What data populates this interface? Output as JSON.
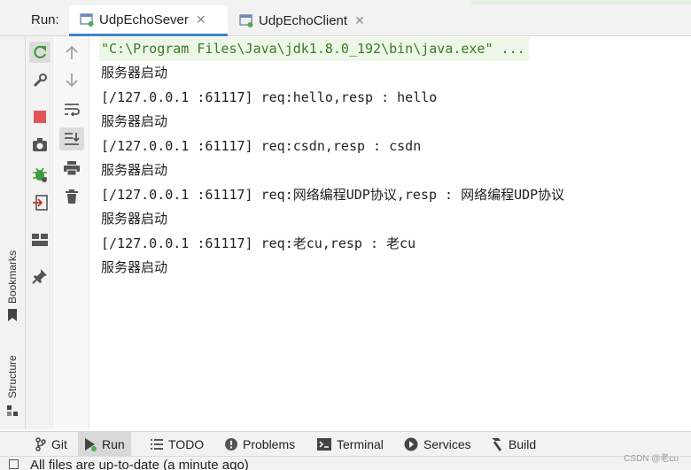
{
  "run_bar": {
    "label": "Run:",
    "tabs": [
      {
        "label": "UdpEchoSever",
        "active": true
      },
      {
        "label": "UdpEchoClient",
        "active": false
      }
    ]
  },
  "left_strip": {
    "bookmarks_label": "Bookmarks",
    "structure_label": "Structure"
  },
  "console": {
    "lines": [
      "\"C:\\Program Files\\Java\\jdk1.8.0_192\\bin\\java.exe\" ...",
      "服务器启动",
      "[/127.0.0.1 :61117] req:hello,resp : hello",
      "服务器启动",
      "[/127.0.0.1 :61117] req:csdn,resp : csdn",
      "服务器启动",
      "[/127.0.0.1 :61117] req:网络编程UDP协议,resp : 网络编程UDP协议",
      "服务器启动",
      "[/127.0.0.1 :61117] req:老cu,resp : 老cu",
      "服务器启动"
    ]
  },
  "bottom_tabs": [
    {
      "label": "Git",
      "icon": "git-branch-icon"
    },
    {
      "label": "Run",
      "icon": "run-icon",
      "active": true
    },
    {
      "label": "TODO",
      "icon": "todo-list-icon"
    },
    {
      "label": "Problems",
      "icon": "problems-icon"
    },
    {
      "label": "Terminal",
      "icon": "terminal-icon"
    },
    {
      "label": "Services",
      "icon": "services-icon"
    },
    {
      "label": "Build",
      "icon": "build-hammer-icon"
    }
  ],
  "status_bar": {
    "text": "All files are up-to-date (a minute ago)"
  },
  "watermark": "CSDN @老cu",
  "colors": {
    "accent": "#4083c9",
    "run_green": "#4caf50",
    "stop_red": "#e05555",
    "command_bg": "#edf6e7"
  }
}
